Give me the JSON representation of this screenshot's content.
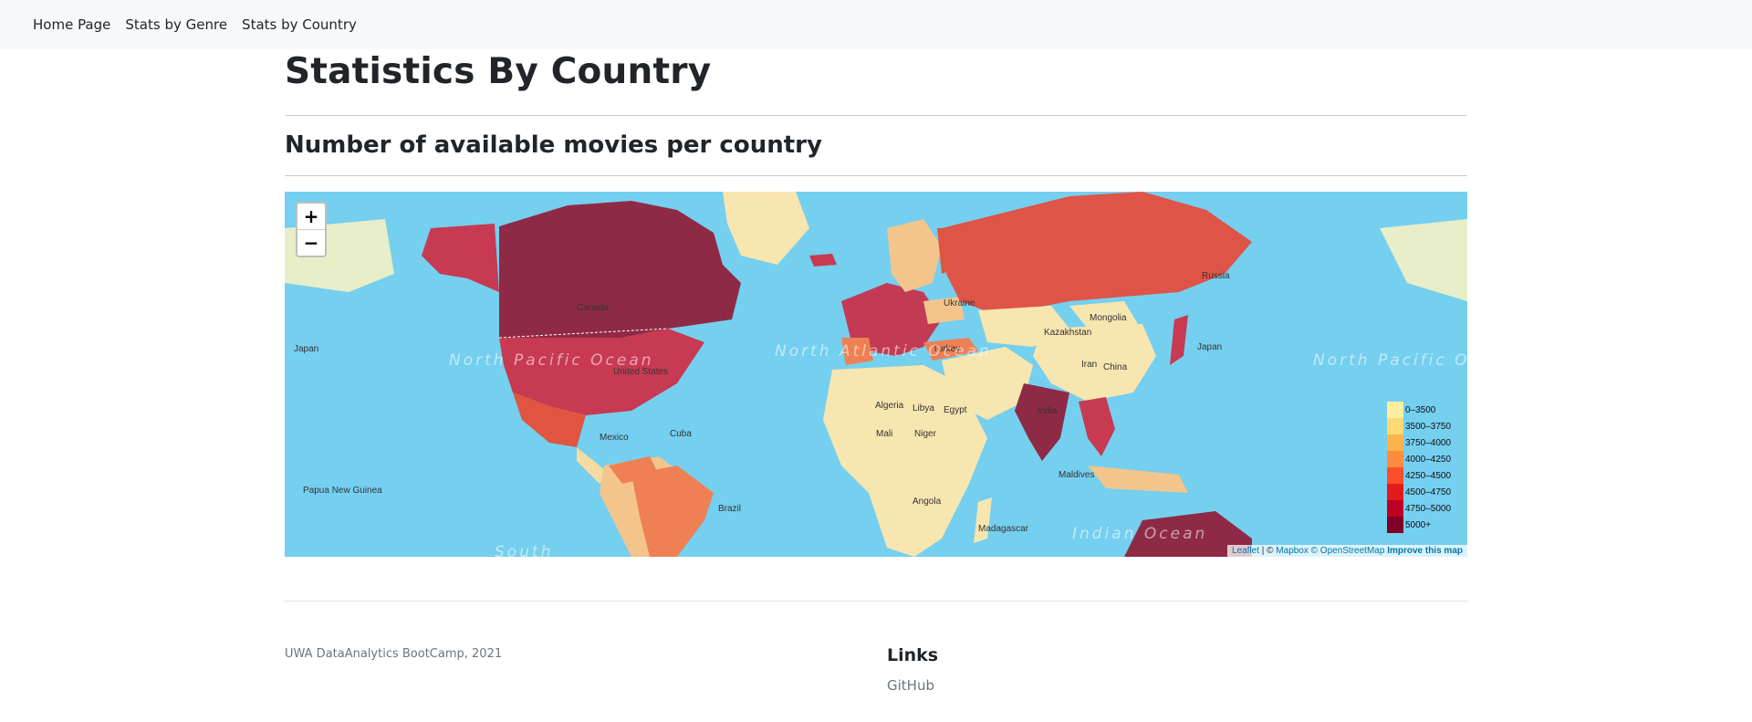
{
  "nav": {
    "items": [
      "Home Page",
      "Stats by Genre",
      "Stats by Country"
    ]
  },
  "page": {
    "title": "Statistics By Country",
    "subtitle": "Number of available movies per country"
  },
  "map": {
    "zoom_in": "+",
    "zoom_out": "−",
    "colors": {
      "ocean": "#75cfef",
      "land_other": "#e8eec8"
    },
    "legend": [
      {
        "label": "0–3500",
        "color": "#ffeda0"
      },
      {
        "label": "3500–3750",
        "color": "#fed976"
      },
      {
        "label": "3750–4000",
        "color": "#feb24c"
      },
      {
        "label": "4000–4250",
        "color": "#fd8d3c"
      },
      {
        "label": "4250–4500",
        "color": "#fc4e2a"
      },
      {
        "label": "4500–4750",
        "color": "#e31a1c"
      },
      {
        "label": "4750–5000",
        "color": "#bd0026"
      },
      {
        "label": "5000+",
        "color": "#800026"
      }
    ],
    "ocean_labels": [
      "North Pacific Ocean",
      "North Atlantic Ocean",
      "North Pacific Ocean",
      "Indian Ocean",
      "South"
    ],
    "country_labels": [
      "Canada",
      "United States",
      "Mexico",
      "Cuba",
      "Brazil",
      "Russia",
      "Kazakhstan",
      "Mongolia",
      "China",
      "Iran",
      "India",
      "Maldives",
      "Algeria",
      "Libya",
      "Egypt",
      "Mali",
      "Niger",
      "Angola",
      "Madagascar",
      "Turkey",
      "Ukraine",
      "Japan",
      "Papua New Guinea",
      "Japan"
    ],
    "attribution": {
      "leaflet": "Leaflet",
      "sep": " | © ",
      "mapbox": "Mapbox",
      "osm": "© OpenStreetMap",
      "improve": "Improve this map"
    }
  },
  "footer": {
    "copyright": "UWA DataAnalytics BootCamp, 2021",
    "links_title": "Links",
    "github": "GitHub"
  }
}
